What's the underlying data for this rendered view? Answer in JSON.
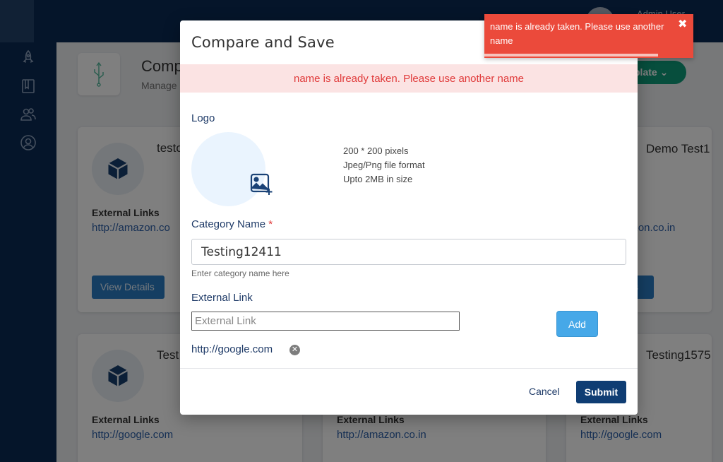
{
  "topbar": {
    "user_name": "Admin User"
  },
  "page": {
    "title": "Comp",
    "subtitle": "Manage",
    "template_button": "plate"
  },
  "cards": [
    {
      "title": "testo",
      "links_label": "External Links",
      "link": "http://amazon.co",
      "button": "View Details"
    },
    {
      "title": "Demo Test1",
      "links_label": "ks",
      "link": "azon.co.in",
      "button": "ls"
    },
    {
      "title": "Test",
      "links_label": "External Links",
      "link": "http://google.com"
    },
    {
      "links_label": "External Links",
      "link": "http://amazon.co.in"
    },
    {
      "title": "Testing1575",
      "links_label": "External Links",
      "link": "http://google.com"
    }
  ],
  "modal": {
    "title": "Compare and Save",
    "alert": "name is already taken. Please use another name",
    "logo_label": "Logo",
    "logo_specs": [
      "200 * 200 pixels",
      "Jpeg/Png file format",
      "Upto 2MB in size"
    ],
    "category_label": "Category Name",
    "required_mark": "*",
    "category_value": "Testing12411",
    "category_help": "Enter category name here",
    "external_link_label": "External Link",
    "external_link_placeholder": "External Link",
    "add_button": "Add",
    "links": [
      "http://google.com"
    ],
    "remove_glyph": "✕",
    "cancel_button": "Cancel",
    "submit_button": "Submit"
  },
  "toast": {
    "message": "name is already taken. Please use another name",
    "close_glyph": "✖",
    "progress": 0.83,
    "color": "#eb4a3b"
  }
}
